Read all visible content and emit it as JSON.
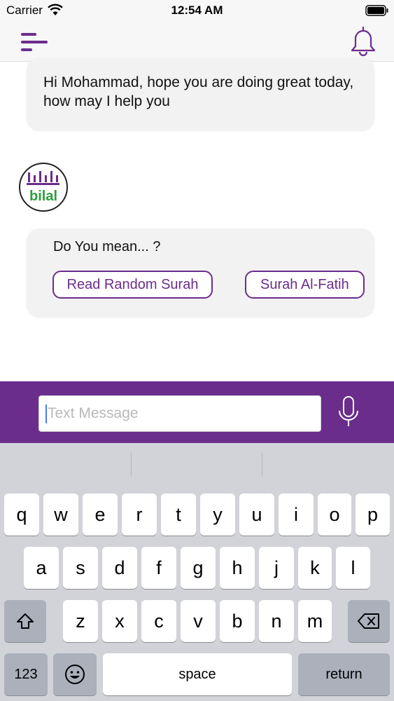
{
  "status_bar": {
    "carrier": "Carrier",
    "time": "12:54 AM"
  },
  "nav": {
    "menu_icon": "menu-icon",
    "bell_icon": "bell-icon"
  },
  "chat": {
    "greeting": "Hi Mohammad, hope you are doing great today, how may I help you",
    "avatar_text": "bilal",
    "prompt": "Do You mean... ?",
    "suggestions": [
      "Read Random Surah",
      "Surah Al-Fatih"
    ]
  },
  "composer": {
    "placeholder": "Text Message",
    "value": "",
    "mic_icon": "microphone-icon"
  },
  "keyboard": {
    "row1": [
      "q",
      "w",
      "e",
      "r",
      "t",
      "y",
      "u",
      "i",
      "o",
      "p"
    ],
    "row2": [
      "a",
      "s",
      "d",
      "f",
      "g",
      "h",
      "j",
      "k",
      "l"
    ],
    "row3": [
      "z",
      "x",
      "c",
      "v",
      "b",
      "n",
      "m"
    ],
    "numbers_key": "123",
    "space_key": "space",
    "return_key": "return",
    "shift_icon": "shift-icon",
    "backspace_icon": "backspace-icon",
    "emoji_icon": "emoji-icon"
  },
  "colors": {
    "accent": "#6b2d8c",
    "green": "#2e9d3c",
    "keyboard_bg": "#d1d3d9"
  }
}
